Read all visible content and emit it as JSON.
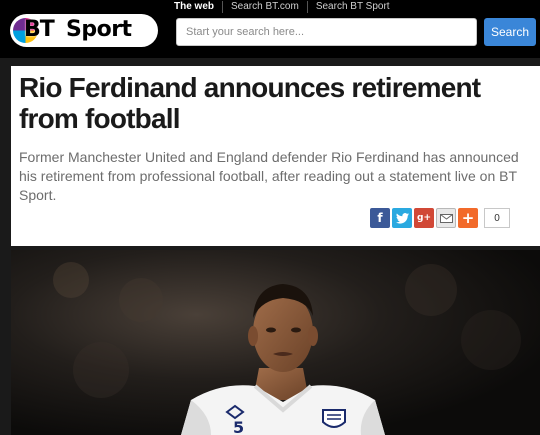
{
  "header": {
    "logo_text_bt": "BT",
    "logo_text_sport": "Sport",
    "search_tabs": [
      {
        "label": "The web",
        "active": true
      },
      {
        "label": "Search BT.com",
        "active": false
      },
      {
        "label": "Search BT Sport",
        "active": false
      }
    ],
    "search_placeholder": "Start your search here...",
    "search_button_label": "Search"
  },
  "article": {
    "headline": "Rio Ferdinand announces retirement from football",
    "standfirst": "Former Manchester United and England defender Rio Ferdinand has announced his retirement from professional football, after reading out a statement live on BT Sport.",
    "share": {
      "facebook_icon": "f",
      "twitter_icon": "t",
      "google_icon": "g+",
      "email_icon": "envelope-icon",
      "more_icon": "+",
      "count": "0"
    }
  },
  "photo": {
    "shirt_number": "5",
    "colors": {
      "shirt": "#f4f4f4",
      "skin": "#8a5a3b",
      "background": "#1c1a18"
    }
  }
}
